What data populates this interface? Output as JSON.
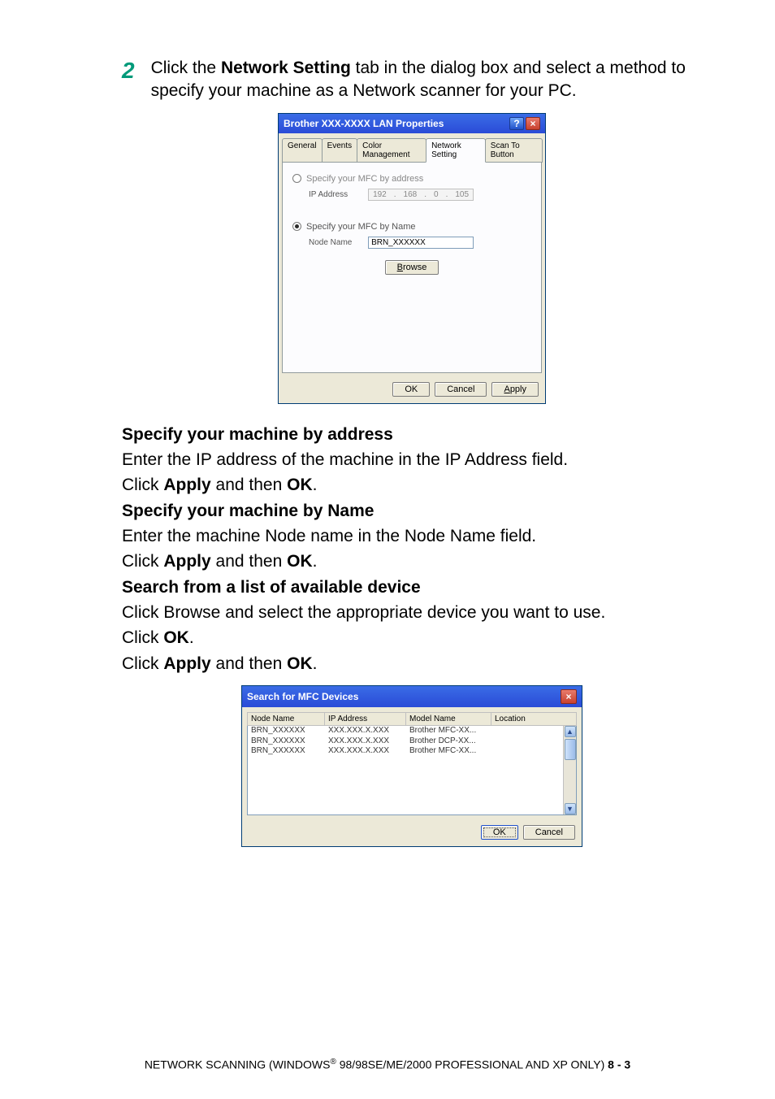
{
  "step": {
    "number": "2",
    "text_pre": "Click the ",
    "text_bold": "Network Setting",
    "text_post": " tab in the dialog box and select a method to specify your machine as a Network scanner for your PC."
  },
  "dialog1": {
    "title": "Brother XXX-XXXX LAN Properties",
    "tabs": [
      "General",
      "Events",
      "Color Management",
      "Network Setting",
      "Scan To Button"
    ],
    "active_tab_index": 3,
    "opt_address_label": "Specify your MFC by address",
    "ip_label": "IP Address",
    "ip_value": [
      "192",
      "168",
      "0",
      "105"
    ],
    "opt_name_label": "Specify your MFC by Name",
    "node_label": "Node Name",
    "node_value": "BRN_XXXXXX",
    "browse": "Browse",
    "ok": "OK",
    "cancel": "Cancel",
    "apply": "Apply"
  },
  "sections": {
    "h1": "Specify your machine by address",
    "p1": "Enter the IP address of the machine in the IP Address field.",
    "p2a": "Click ",
    "p2b": "Apply",
    "p2c": " and then ",
    "p2d": "OK",
    "p2e": ".",
    "h2": "Specify your machine by Name",
    "p3": "Enter the machine Node name in the Node Name field.",
    "h3": "Search from a list of available device",
    "p4": "Click Browse and select the appropriate device you want to use.",
    "p5a": "Click ",
    "p5b": "OK",
    "p5c": "."
  },
  "dialog2": {
    "title": "Search for MFC Devices",
    "cols": [
      "Node Name",
      "IP Address",
      "Model Name",
      "Location"
    ],
    "rows": [
      {
        "node": "BRN_XXXXXX",
        "ip": "XXX.XXX.X.XXX",
        "model": "Brother MFC-XX...",
        "loc": ""
      },
      {
        "node": "BRN_XXXXXX",
        "ip": "XXX.XXX.X.XXX",
        "model": "Brother DCP-XX...",
        "loc": ""
      },
      {
        "node": "BRN_XXXXXX",
        "ip": "XXX.XXX.X.XXX",
        "model": "Brother MFC-XX...",
        "loc": ""
      }
    ],
    "ok": "OK",
    "cancel": "Cancel"
  },
  "footer": {
    "left": "NETWORK SCANNING (WINDOWS",
    "reg": "®",
    "mid": " 98/98SE/ME/2000 PROFESSIONAL AND XP ONLY)   ",
    "page": "8 - 3"
  }
}
